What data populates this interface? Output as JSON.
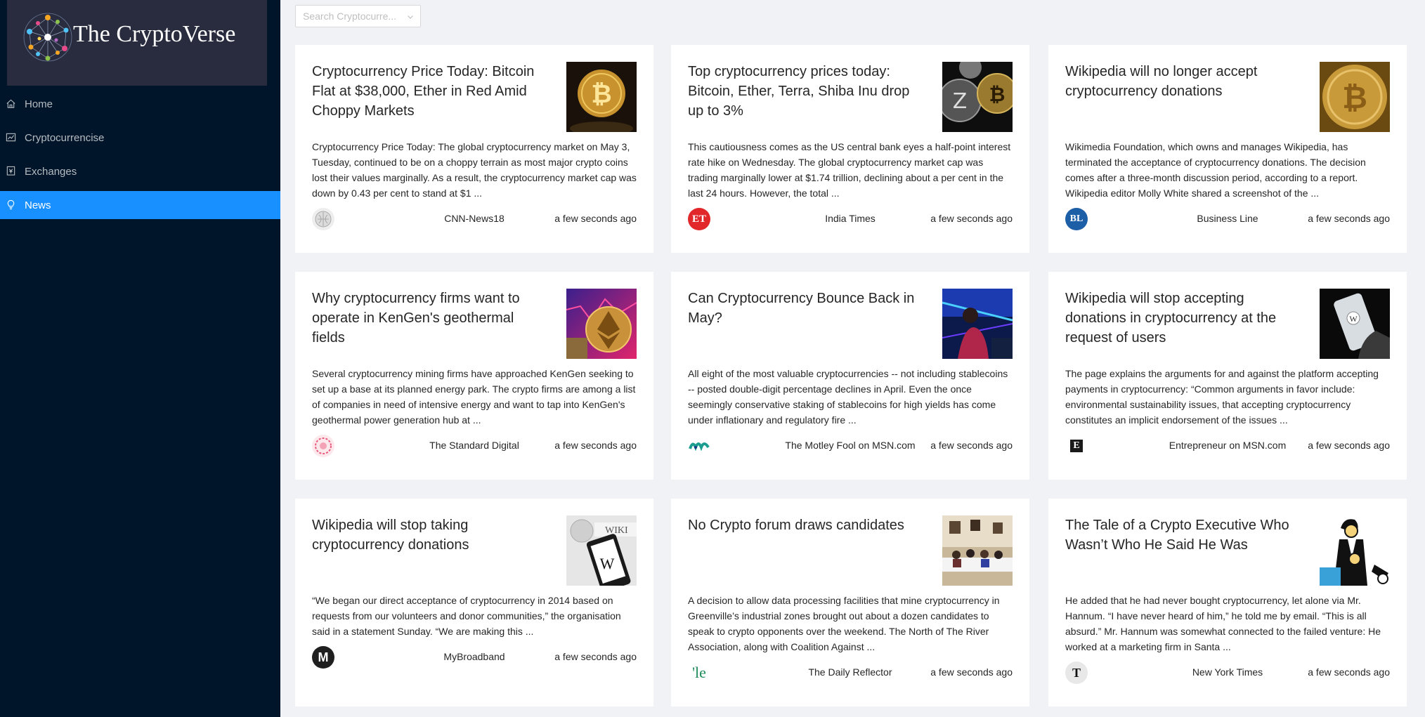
{
  "app": {
    "title": "The CryptoVerse"
  },
  "sidebar": {
    "items": [
      {
        "label": "Home",
        "icon": "home-icon",
        "active": false
      },
      {
        "label": "Cryptocurrencise",
        "icon": "fund-icon",
        "active": false
      },
      {
        "label": "Exchanges",
        "icon": "money-collect-icon",
        "active": false
      },
      {
        "label": "News",
        "icon": "bulb-icon",
        "active": true
      }
    ]
  },
  "search": {
    "placeholder": "Search Cryptocurre..."
  },
  "colors": {
    "sidebar_bg": "#001529",
    "logo_bg": "#282c3e",
    "active": "#1890ff",
    "page_bg": "#f0f2f5"
  },
  "news": [
    {
      "title": "Cryptocurrency Price Today: Bitcoin Flat at $38,000, Ether in Red Amid Choppy Markets",
      "description": "Cryptocurrency Price Today: The global cryptocurrency market on May 3, Tuesday, continued to be on a choppy terrain as most major crypto coins lost their values marginally. As a result, the cryptocurrency market cap was down by 0.43 per cent to stand at $1 ...",
      "provider": "CNN-News18",
      "time": "a few seconds ago"
    },
    {
      "title": "Top cryptocurrency prices today: Bitcoin, Ether, Terra, Shiba Inu drop up to 3%",
      "description": "This cautiousness comes as the US central bank eyes a half-point interest rate hike on Wednesday. The global cryptocurrency market cap was trading marginally lower at $1.74 trillion, declining about a per cent in the last 24 hours. However, the total ...",
      "provider": "India Times",
      "provider_icon_text": "ET",
      "time": "a few seconds ago"
    },
    {
      "title": "Wikipedia will no longer accept cryptocurrency donations",
      "description": "Wikimedia Foundation, which owns and manages Wikipedia, has terminated the acceptance of cryptocurrency donations. The decision comes after a three-month discussion period, according to a report. Wikipedia editor Molly White shared a screenshot of the ...",
      "provider": "Business Line",
      "provider_icon_text": "BL",
      "time": "a few seconds ago"
    },
    {
      "title": "Why cryptocurrency firms want to operate in KenGen's geothermal fields",
      "description": "Several cryptocurrency mining firms have approached KenGen seeking to set up a base at its planned energy park. The crypto firms are among a list of companies in need of intensive energy and want to tap into KenGen's geothermal power generation hub at ...",
      "provider": "The Standard Digital",
      "time": "a few seconds ago"
    },
    {
      "title": "Can Cryptocurrency Bounce Back in May?",
      "description": "All eight of the most valuable cryptocurrencies -- not including stablecoins -- posted double-digit percentage declines in April. Even the once seemingly conservative staking of stablecoins for high yields has come under inflationary and regulatory fire ...",
      "provider": "The Motley Fool on MSN.com",
      "time": "a few seconds ago"
    },
    {
      "title": "Wikipedia will stop accepting donations in cryptocurrency at the request of users",
      "description": "The page explains the arguments for and against the platform accepting payments in cryptocurrency: “Common arguments in favor include: environmental sustainability issues, that accepting cryptocurrency constitutes an implicit endorsement of the issues ...",
      "provider": "Entrepreneur on MSN.com",
      "provider_icon_text": "E",
      "time": "a few seconds ago"
    },
    {
      "title": "Wikipedia will stop taking cryptocurrency donations",
      "description": "“We began our direct acceptance of cryptocurrency in 2014 based on requests from our volunteers and donor communities,” the organisation said in a statement Sunday. “We are making this ...",
      "provider": "MyBroadband",
      "provider_icon_text": "M",
      "time": "a few seconds ago"
    },
    {
      "title": "No Crypto forum draws candidates",
      "description": "A decision to allow data processing facilities that mine cryptocurrency in Greenville’s industrial zones brought out about a dozen candidates to speak to crypto opponents over the weekend. The North of The River Association, along with Coalition Against ...",
      "provider": "The Daily Reflector",
      "provider_icon_text": "'le",
      "time": "a few seconds ago"
    },
    {
      "title": "The Tale of a Crypto Executive Who Wasn’t Who He Said He Was",
      "description": "He added that he had never bought cryptocurrency, let alone via Mr. Hannum. “I have never heard of him,” he told me by email. “This is all absurd.” Mr. Hannum was somewhat connected to the failed venture: He worked at a marketing firm in Santa ...",
      "provider": "New York Times",
      "provider_icon_text": "T",
      "time": "a few seconds ago"
    }
  ]
}
